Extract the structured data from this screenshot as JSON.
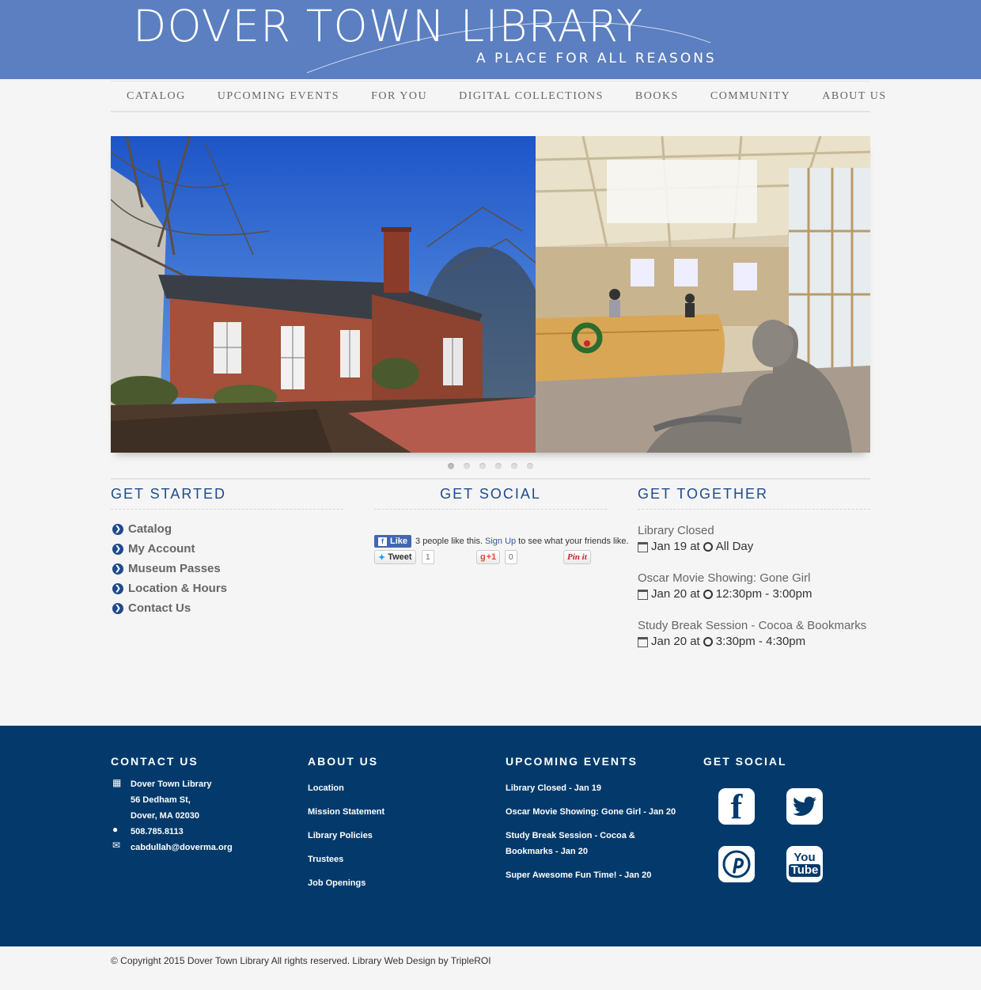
{
  "header": {
    "title": "DOVER TOWN LIBRARY",
    "tagline": "A PLACE FOR ALL REASONS"
  },
  "nav": {
    "items": [
      "CATALOG",
      "UPCOMING EVENTS",
      "FOR YOU",
      "DIGITAL COLLECTIONS",
      "BOOKS",
      "COMMUNITY",
      "ABOUT US"
    ]
  },
  "slider": {
    "slide_count": 6,
    "active_index": 0
  },
  "get_started": {
    "title": "GET STARTED",
    "links": [
      "Catalog",
      "My Account",
      "Museum Passes",
      "Location & Hours",
      "Contact Us"
    ]
  },
  "get_social": {
    "title": "GET SOCIAL",
    "fb_like_label": "Like",
    "fb_text_1": "3 people like this.",
    "fb_signup": "Sign Up",
    "fb_text_2": "to see what your friends like.",
    "tweet_label": "Tweet",
    "tweet_count": "1",
    "gplus_label": "+1",
    "gplus_count": "0",
    "pin_label": "Pin it"
  },
  "get_together": {
    "title": "GET TOGETHER",
    "at": "at",
    "events": [
      {
        "title": "Library Closed",
        "date": "Jan 19",
        "time": "All Day"
      },
      {
        "title": "Oscar Movie Showing: Gone Girl",
        "date": "Jan 20",
        "time": "12:30pm - 3:00pm"
      },
      {
        "title": "Study Break Session - Cocoa & Bookmarks",
        "date": "Jan 20",
        "time": "3:30pm - 4:30pm"
      }
    ]
  },
  "footer": {
    "contact": {
      "title": "CONTACT US",
      "name": "Dover Town Library",
      "street": "56 Dedham St,",
      "city": "Dover, MA  02030",
      "phone": "508.785.8113",
      "email": "cabdullah@doverma.org"
    },
    "about": {
      "title": "ABOUT US",
      "links": [
        "Location",
        "Mission Statement",
        "Library Policies",
        "Trustees",
        "Job Openings"
      ]
    },
    "events": {
      "title": "UPCOMING EVENTS",
      "links": [
        "Library Closed - Jan 19",
        "Oscar Movie Showing: Gone Girl - Jan 20",
        "Study Break Session - Cocoa &",
        "Bookmarks - Jan 20",
        "Super Awesome Fun Time! - Jan 20"
      ]
    },
    "social": {
      "title": "GET SOCIAL",
      "icons": [
        "facebook-icon",
        "twitter-icon",
        "pinterest-icon",
        "youtube-icon"
      ],
      "youtube_you": "You",
      "youtube_tube": "Tube"
    }
  },
  "copyright": "© Copyright 2015 Dover Town Library All rights reserved. Library Web Design by TripleROI",
  "colors": {
    "header_bg": "#5b7fc0",
    "accent_navy": "#1f4a8c",
    "footer_bg": "#033a6b"
  }
}
